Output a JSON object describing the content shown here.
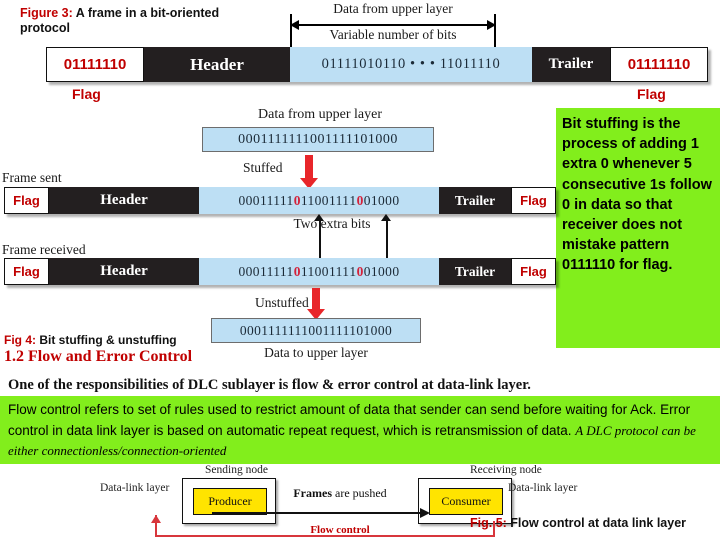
{
  "figure3": {
    "caption_label": "Figure 3:",
    "caption_text": " A frame in a bit-oriented protocol",
    "top_bracket_label": "Data from upper layer",
    "top_bracket_sublabel": "Variable number of bits",
    "cells": {
      "flag_left": "01111110",
      "header": "Header",
      "data": "01111010110  • • •  11011110",
      "trailer": "Trailer",
      "flag_right": "01111110"
    },
    "flag_left_caption": "Flag",
    "flag_right_caption": "Flag"
  },
  "callout": {
    "text": "Bit stuffing is the process of adding 1 extra 0 whenever 5 consecutive 1s follow  0 in data so that receiver does not mistake pattern 0111110 for flag.",
    "bg_color": "#82ee1c"
  },
  "figure4": {
    "data_from_upper_label": "Data from upper layer",
    "data_original": "0001111111001111101000",
    "stuffed_label": "Stuffed",
    "frame_sent_label": "Frame sent",
    "frame_received_label": "Frame received",
    "frame_flag": "Flag",
    "frame_header": "Header",
    "frame_trailer": "Trailer",
    "stuffed_parts": {
      "p1": "00011111",
      "stuff1": "0",
      "p2": "1100111",
      "p3": "1",
      "stuff2": "0",
      "p4": "01000"
    },
    "stuffed_full": "000111110110011111001000",
    "two_extra_bits_label": "Two extra bits",
    "unstuffed_label": "Unstuffed",
    "data_unstuffed": "0001111111001111101000",
    "data_to_upper_label": "Data to upper layer",
    "caption_num": "Fig 4:",
    "caption_text": " Bit stuffing & unstuffing"
  },
  "section": {
    "heading": "1.2  Flow and Error Control",
    "responsibility_line": "One of the responsibilities of DLC sublayer is flow & error control at data-link layer.",
    "paragraph_main": "Flow control refers to set of rules used to restrict  amount of data that sender can send before waiting for Ack. Error control in data link layer is based on automatic repeat request, which is retransmission of data. ",
    "paragraph_italic": "A DLC protocol can be either connectionless/connection-oriented",
    "paragraph_bg": "#82ee1c"
  },
  "figure5": {
    "sending_node_label": "Sending node",
    "receiving_node_label": "Receiving node",
    "producer_label": "Producer",
    "consumer_label": "Consumer",
    "data_link_layer_left": "Data-link layer",
    "data_link_layer_right": "Data-link layer",
    "frames_pushed_bold": "Frames",
    "frames_pushed_rest": " are pushed",
    "flow_control_label": "Flow control",
    "caption_num": "Fig. 5:",
    "caption_text": " Flow control at data link layer"
  },
  "colors": {
    "red": "#c00000",
    "data_blue": "#bddff4",
    "dark": "#231f20",
    "yellow": "#ffe400",
    "green": "#82ee1c"
  }
}
